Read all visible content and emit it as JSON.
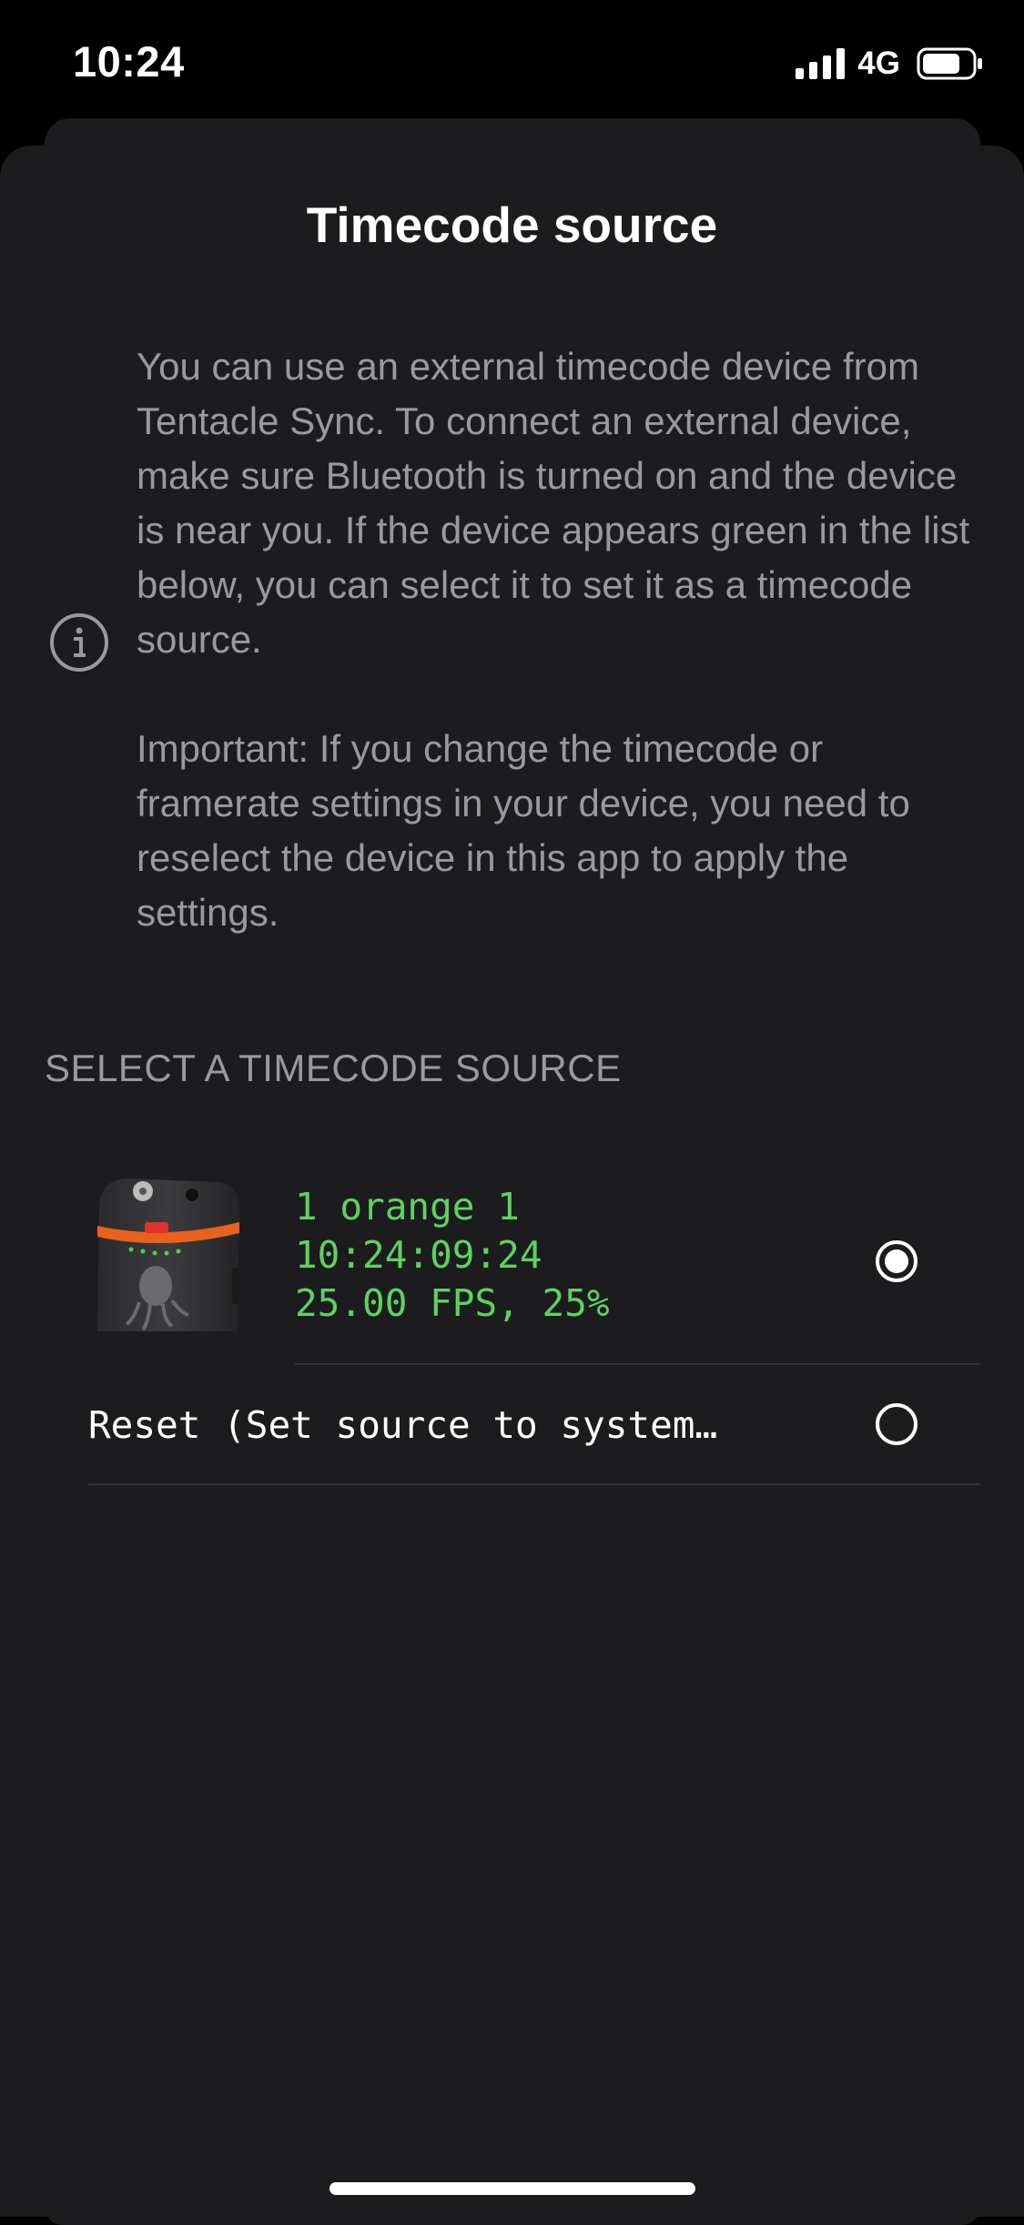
{
  "status_bar": {
    "time": "10:24",
    "network": "4G",
    "icons": [
      "signal-bars-icon",
      "battery-icon"
    ]
  },
  "sheet": {
    "title": "Timecode source",
    "info_paragraph_1": "You can use an external timecode device from Tentacle Sync. To connect an external device, make sure Bluetooth is turned on and the device is near you. If the device appears green in the list below, you can select it to set it as a timecode source.",
    "info_paragraph_2": "Important: If you change the timecode or framerate settings in your device, you need to reselect the device in this app to apply the settings.",
    "info_icon": "info-circle-icon"
  },
  "sources": {
    "header": "SELECT A TIMECODE SOURCE",
    "device": {
      "name": "1 orange 1",
      "timecode": "10:24:09:24",
      "fps_battery": "25.00 FPS, 25%",
      "selected": true,
      "color": "#5dd35f"
    },
    "reset": {
      "label": "Reset (Set source to system…",
      "selected": false
    }
  },
  "colors": {
    "background": "#000000",
    "sheet": "#1c1c1e",
    "secondary_text": "#9a9a9e",
    "accent_green": "#5dd35f"
  }
}
